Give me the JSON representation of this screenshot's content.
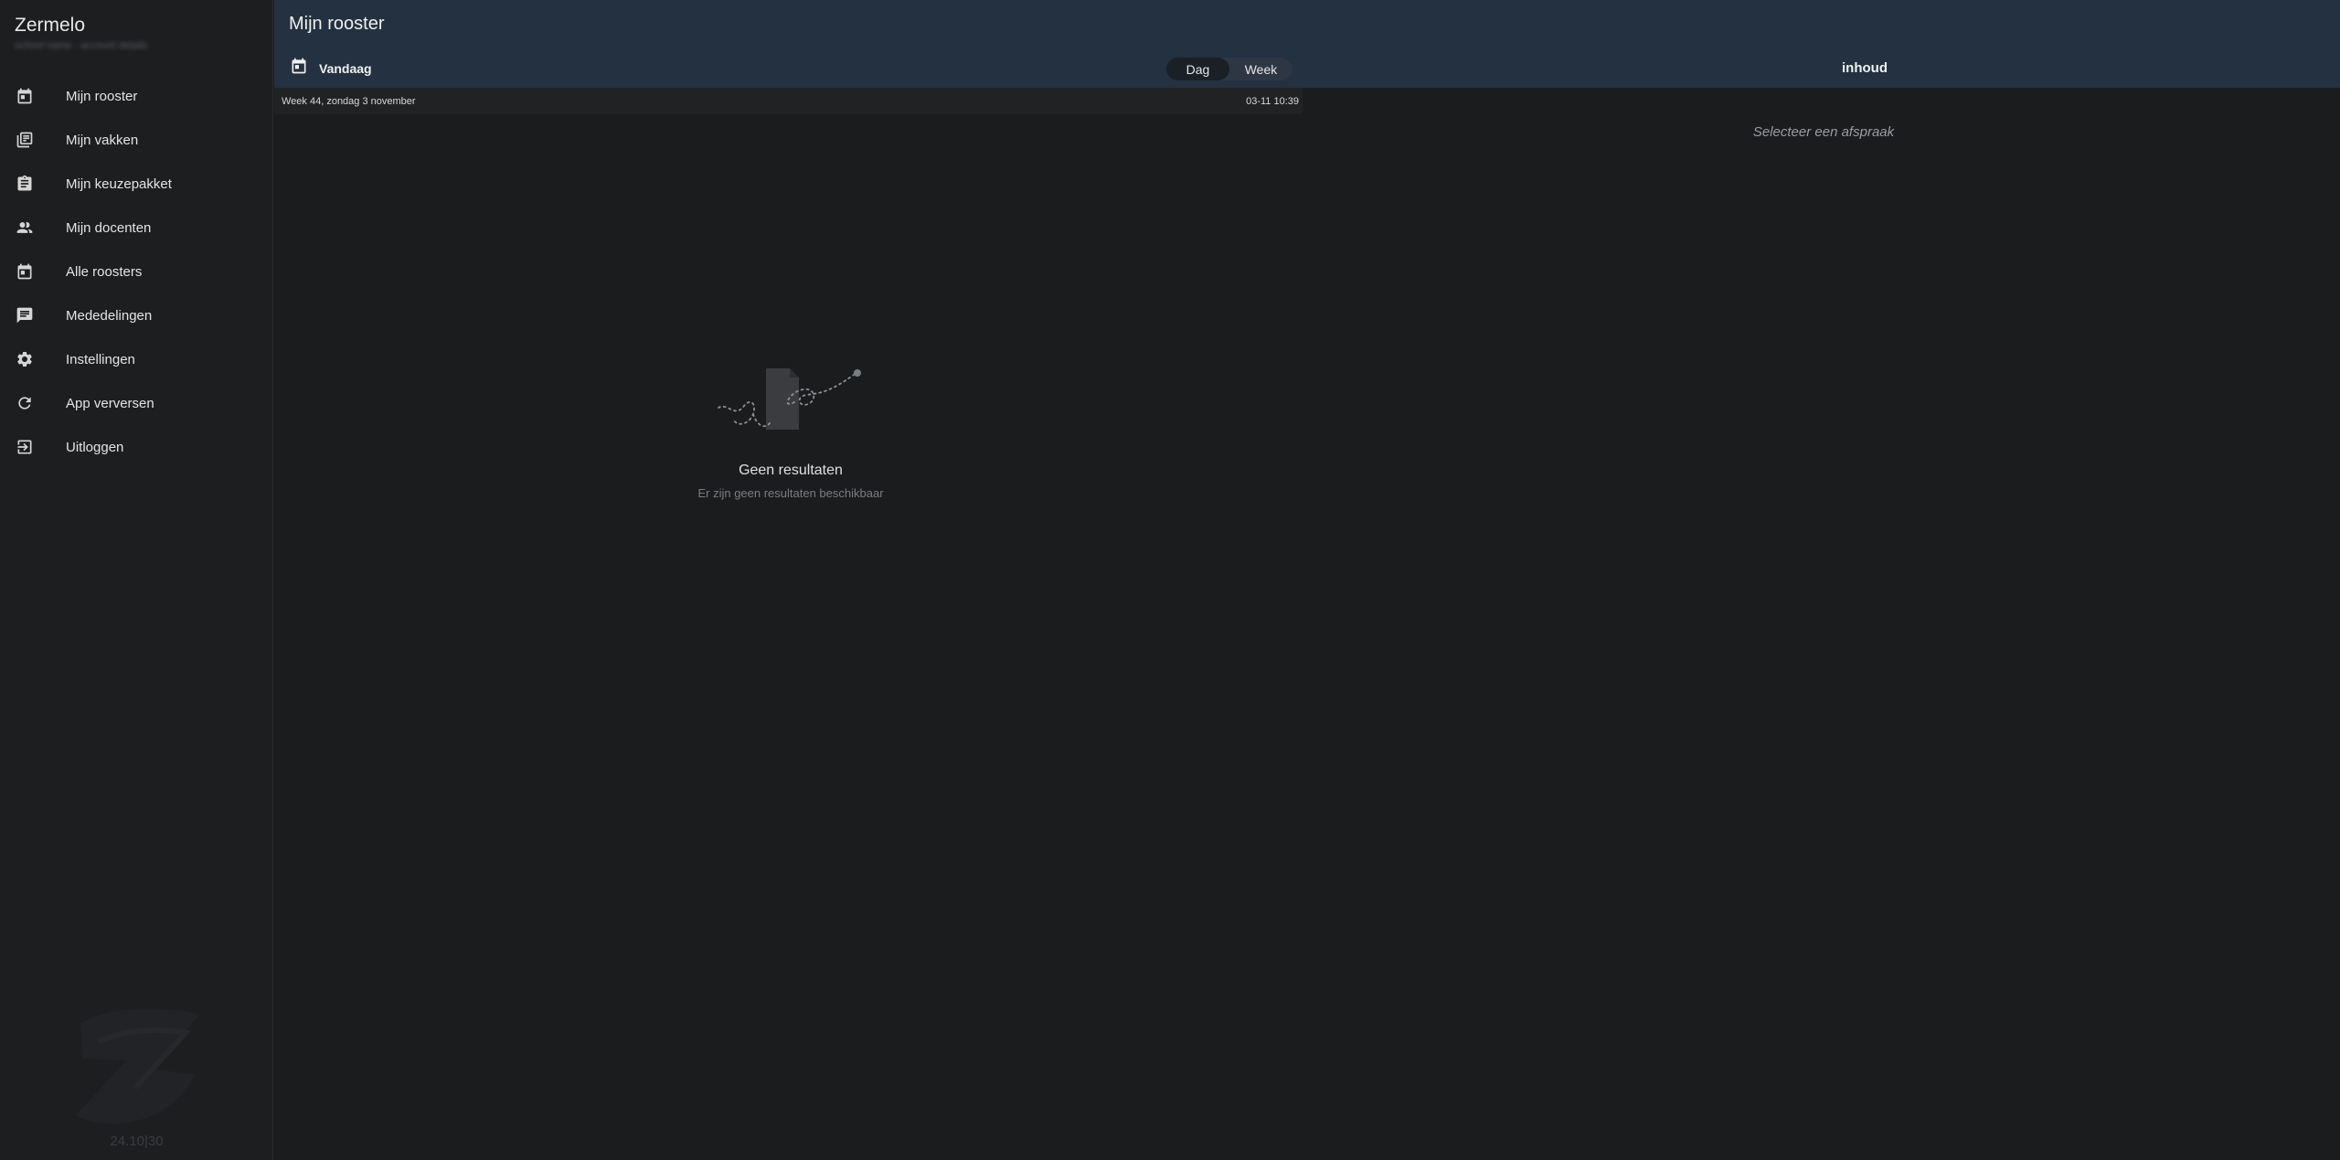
{
  "sidebar": {
    "brand": "Zermelo",
    "subtitle": "school name · account details",
    "items": [
      {
        "label": "Mijn rooster",
        "icon": "calendar-icon"
      },
      {
        "label": "Mijn vakken",
        "icon": "library-books-icon"
      },
      {
        "label": "Mijn keuzepakket",
        "icon": "clipboard-icon"
      },
      {
        "label": "Mijn docenten",
        "icon": "people-icon"
      },
      {
        "label": "Alle roosters",
        "icon": "calendar-icon"
      },
      {
        "label": "Mededelingen",
        "icon": "message-icon"
      },
      {
        "label": "Instellingen",
        "icon": "gear-icon"
      },
      {
        "label": "App verversen",
        "icon": "refresh-icon"
      },
      {
        "label": "Uitloggen",
        "icon": "logout-icon"
      }
    ],
    "version": "24.10|30"
  },
  "header": {
    "title": "Mijn rooster",
    "today_label": "Vandaag",
    "view_toggle": {
      "day": "Dag",
      "week": "Week",
      "selected": "Dag"
    },
    "content_title": "inhoud"
  },
  "date_strip": {
    "left": "Week 44, zondag 3 november",
    "right": "03-11 10:39"
  },
  "empty_state": {
    "title": "Geen resultaten",
    "subtitle": "Er zijn geen resultaten beschikbaar"
  },
  "detail_panel": {
    "hint": "Selecteer een afspraak"
  }
}
